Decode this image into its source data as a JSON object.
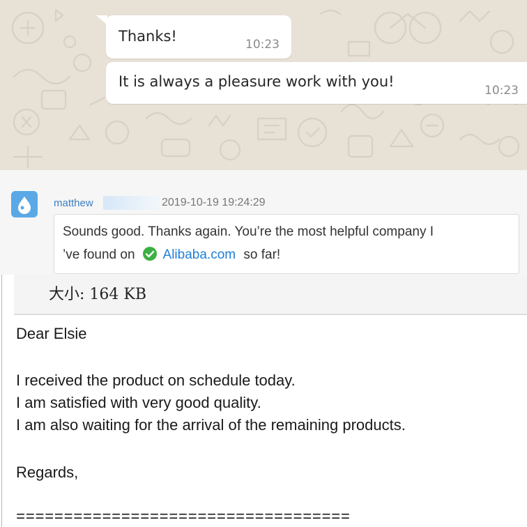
{
  "whatsapp": {
    "messages": [
      {
        "text": "Thanks!",
        "time": "10:23"
      },
      {
        "text": "It is always a pleasure work with you!",
        "time": "10:23"
      }
    ],
    "colors": {
      "background": "#e7e1d6",
      "bubble": "#ffffff",
      "time": "#8a8a8a"
    }
  },
  "alibaba": {
    "sender": "matthew",
    "timestamp": "2019-10-19 19:24:29",
    "message": {
      "line1": "Sounds good. Thanks again. You’re the most helpful company I",
      "line2_prefix": "’ve found on",
      "link": "Alibaba.com",
      "line2_suffix": "so far!"
    },
    "icons": {
      "avatar": "avatar-drop-icon",
      "verified": "verified-check-icon"
    },
    "colors": {
      "link": "#1f7fd6",
      "check": "#3cb043",
      "sender": "#3d7fc2"
    }
  },
  "email": {
    "attachment_size": "大小: 164 KB",
    "greeting": "Dear Elsie",
    "body_lines": [
      "I received the product on schedule today.",
      "I am satisfied with very good quality.",
      "I am also waiting for the arrival of the remaining products."
    ],
    "closing": "Regards,",
    "separator": "==================================="
  }
}
